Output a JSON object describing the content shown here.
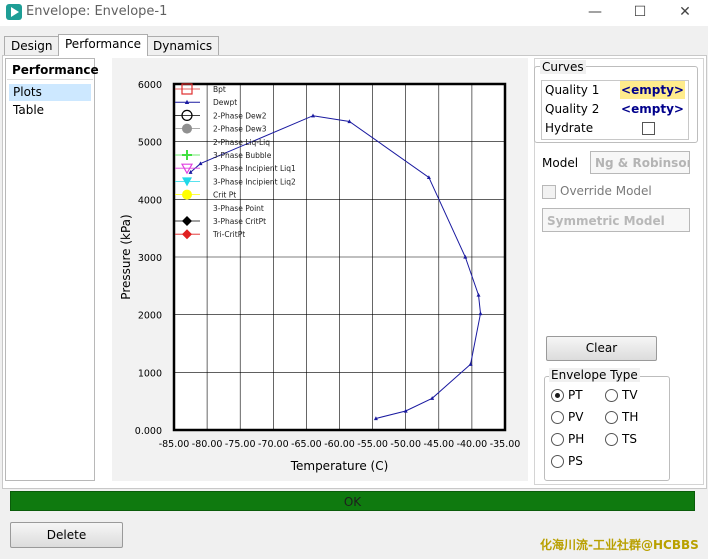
{
  "window": {
    "title": "Envelope: Envelope-1",
    "minimize": "—",
    "maximize": "☐",
    "close": "✕"
  },
  "tabs": [
    {
      "label": "Design"
    },
    {
      "label": "Performance"
    },
    {
      "label": "Dynamics"
    }
  ],
  "nav": {
    "header": "Performance",
    "items": [
      {
        "label": "Plots"
      },
      {
        "label": "Table"
      }
    ]
  },
  "chart_data": {
    "type": "line",
    "xlabel": "Temperature (C)",
    "ylabel": "Pressure (kPa)",
    "xlim": [
      -85,
      -35
    ],
    "ylim": [
      0,
      6000
    ],
    "xticks": [
      "-85.00",
      "-80.00",
      "-75.00",
      "-70.00",
      "-65.00",
      "-60.00",
      "-55.00",
      "-50.00",
      "-45.00",
      "-40.00",
      "-35.00"
    ],
    "yticks": [
      "0.000",
      "1000",
      "2000",
      "3000",
      "4000",
      "5000",
      "6000"
    ],
    "grid": true,
    "legend_position": "top-left",
    "legend": [
      {
        "label": "Bpt",
        "marker": "square-open",
        "color": "#e03030"
      },
      {
        "label": "Dewpt",
        "marker": "triangle",
        "color": "#1a1aa0"
      },
      {
        "label": "2-Phase Dew2",
        "marker": "circle-open",
        "color": "#000000"
      },
      {
        "label": "2-Phase Dew3",
        "marker": "circle",
        "color": "#909090"
      },
      {
        "label": "2-Phase Liq-Liq",
        "marker": "none",
        "color": "#000000"
      },
      {
        "label": "3-Phase Bubble",
        "marker": "plus",
        "color": "#40e040"
      },
      {
        "label": "3-Phase Incipient Liq1",
        "marker": "triangle-down-open",
        "color": "#e040e0"
      },
      {
        "label": "3-Phase Incipient Liq2",
        "marker": "triangle-down",
        "color": "#20d8e8"
      },
      {
        "label": "Crit Pt",
        "marker": "circle",
        "color": "#ffff00"
      },
      {
        "label": "3-Phase Point",
        "marker": "none",
        "color": "#000000"
      },
      {
        "label": "3-Phase CritPt",
        "marker": "diamond",
        "color": "#000000"
      },
      {
        "label": "Tri-CritPt",
        "marker": "diamond",
        "color": "#e02020"
      }
    ],
    "series": [
      {
        "name": "Dewpt",
        "color": "#1a1aa0",
        "x": [
          -54.5,
          -50.0,
          -46.0,
          -40.2,
          -38.7,
          -39.0,
          -41.0,
          -46.5,
          -58.5,
          -64.0,
          -81.0,
          -82.5
        ],
        "y": [
          200,
          330,
          550,
          1140,
          2020,
          2340,
          3000,
          4380,
          5350,
          5450,
          4620,
          4470
        ]
      }
    ]
  },
  "curves": {
    "title": "Curves",
    "rows": [
      {
        "label": "Quality 1",
        "value": "<empty>"
      },
      {
        "label": "Quality 2",
        "value": "<empty>"
      },
      {
        "label": "Hydrate",
        "value": ""
      }
    ]
  },
  "model": {
    "label": "Model",
    "value": "Ng & Robinson",
    "override_label": "Override Model",
    "symmetric_value": "Symmetric Model"
  },
  "clear_label": "Clear",
  "envelope_type": {
    "title": "Envelope Type",
    "options": [
      {
        "label": "PT",
        "selected": true
      },
      {
        "label": "TV",
        "selected": false
      },
      {
        "label": "PV",
        "selected": false
      },
      {
        "label": "TH",
        "selected": false
      },
      {
        "label": "PH",
        "selected": false
      },
      {
        "label": "TS",
        "selected": false
      },
      {
        "label": "PS",
        "selected": false
      }
    ]
  },
  "status": "OK",
  "delete_label": "Delete",
  "watermark": "化海川流-工业社群@HCBBS"
}
